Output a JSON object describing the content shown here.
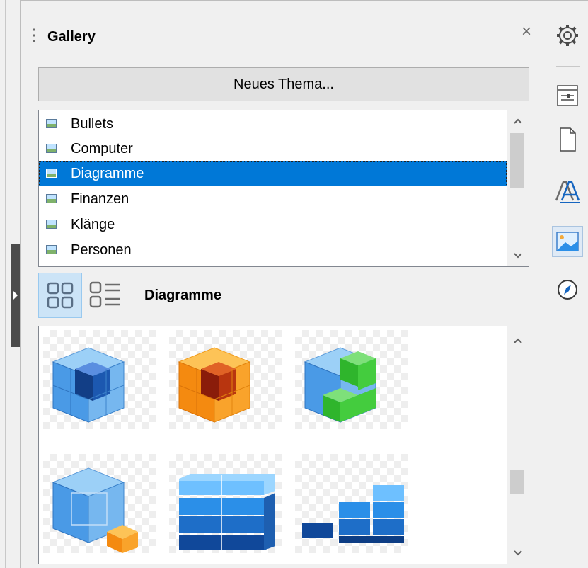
{
  "panel": {
    "title": "Gallery",
    "close_symbol": "×",
    "new_theme_button": "Neues Thema..."
  },
  "themes": {
    "items": [
      {
        "label": "Bullets",
        "icon": "image-icon"
      },
      {
        "label": "Computer",
        "icon": "image-icon"
      },
      {
        "label": "Diagramme",
        "icon": "image-icon",
        "selected": true
      },
      {
        "label": "Finanzen",
        "icon": "image-icon"
      },
      {
        "label": "Klänge",
        "icon": "image-icon"
      },
      {
        "label": "Personen",
        "icon": "image-icon"
      }
    ],
    "scroll_up": "^",
    "scroll_down": "v"
  },
  "view_toolbar": {
    "icon_view": "icon-view-icon",
    "detail_view": "detail-view-icon",
    "current_theme": "Diagramme"
  },
  "gallery_items": [
    {
      "name": "blue-cube-diagram"
    },
    {
      "name": "orange-cube-diagram"
    },
    {
      "name": "blue-green-cube-diagram"
    },
    {
      "name": "blue-cube-with-orange-block"
    },
    {
      "name": "blue-stacked-blocks"
    },
    {
      "name": "blue-steps-blocks"
    }
  ],
  "sidebar_tabs": [
    {
      "name": "settings-icon"
    },
    {
      "name": "properties-icon"
    },
    {
      "name": "page-icon"
    },
    {
      "name": "styles-icon"
    },
    {
      "name": "gallery-icon",
      "active": true
    },
    {
      "name": "navigator-icon"
    }
  ],
  "colors": {
    "selection": "#0078d7",
    "active_tab": "#dfeaf6",
    "button": "#e1e1e1"
  }
}
